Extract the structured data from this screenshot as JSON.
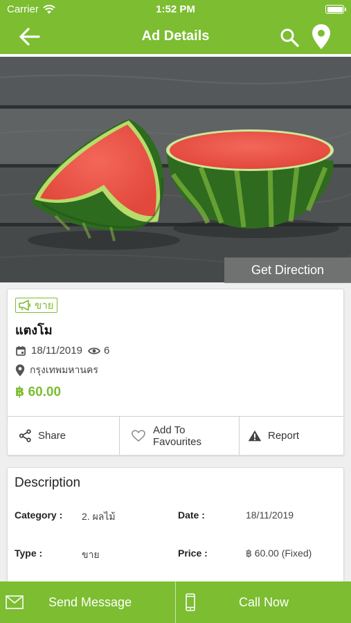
{
  "status": {
    "carrier": "Carrier",
    "time": "1:52 PM"
  },
  "nav": {
    "title": "Ad Details"
  },
  "hero": {
    "get_direction": "Get Direction"
  },
  "ad": {
    "badge": "ขาย",
    "title": "แตงโม",
    "date": "18/11/2019",
    "views": "6",
    "location": "กรุงเทพมหานคร",
    "price": "฿ 60.00"
  },
  "actions": {
    "share": "Share",
    "favourites_line1": "Add To",
    "favourites_line2": "Favourites",
    "report": "Report"
  },
  "description": {
    "heading": "Description",
    "category_label": "Category :",
    "category_value": "2. ผลไม้",
    "date_label": "Date :",
    "date_value": "18/11/2019",
    "type_label": "Type :",
    "type_value": "ขาย",
    "price_label": "Price :",
    "price_value": "฿ 60.00 (Fixed)"
  },
  "bottom": {
    "send_message": "Send Message",
    "call_now": "Call Now"
  },
  "colors": {
    "brand_green": "#7cbd31",
    "white": "#ffffff"
  }
}
